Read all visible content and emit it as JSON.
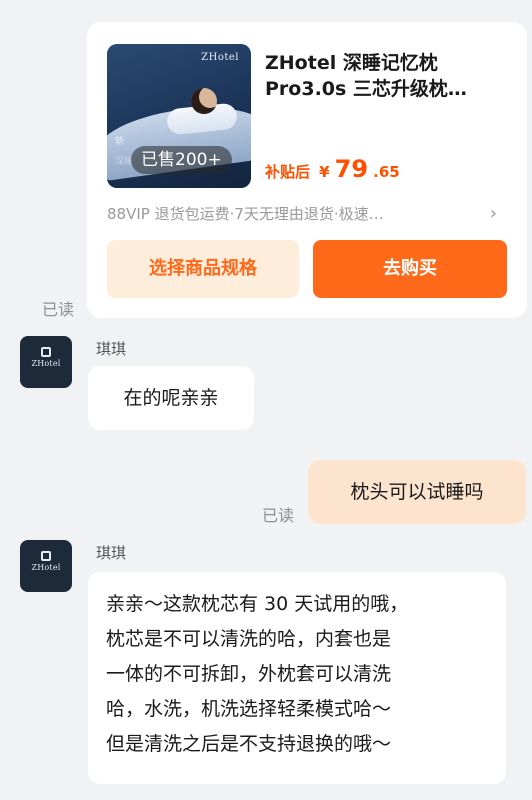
{
  "product": {
    "image_brand": "ZHotel",
    "image_new": "新",
    "image_sub": "深睡",
    "sold": "已售200+",
    "title": "ZHotel 深睡记忆枕Pro3.0s 三芯升级枕…",
    "price_label": "补贴后",
    "price_currency": "¥",
    "price_integer": "79",
    "price_decimal": ".65",
    "services": "88VIP 退货包运费·7天无理由退货·极速…",
    "spec_button": "选择商品规格",
    "buy_button": "去购买"
  },
  "read_label": "已读",
  "avatar_text": "ZHotel",
  "messages": [
    {
      "sender": "琪琪",
      "text": "在的呢亲亲"
    },
    {
      "text": "枕头可以试睡吗"
    },
    {
      "sender": "琪琪",
      "lines": [
        "亲亲～这款枕芯有 30 天试用的哦，",
        "枕芯是不可以清洗的哈，内套也是",
        "一体的不可拆卸，外枕套可以清洗",
        "哈，水洗，机洗选择轻柔模式哈～",
        "但是清洗之后是不支持退换的哦～"
      ]
    }
  ],
  "colors": {
    "accent": "#ff6a1a",
    "price": "#ff5000",
    "spec_button_bg": "#ffeddc",
    "outgoing_bubble": "#fde4cf",
    "page_bg": "#f1f2f4"
  }
}
